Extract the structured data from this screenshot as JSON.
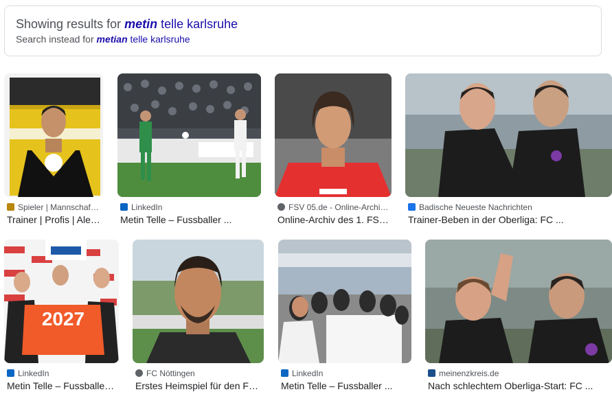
{
  "spelling": {
    "showing_prefix": "Showing results for",
    "corrected_bold": "metin",
    "corrected_rest": "telle karlsruhe",
    "instead_prefix": "Search instead for",
    "original_bold": "metian",
    "original_rest": "telle karlsruhe"
  },
  "results": [
    {
      "source": "Spieler | Mannschaf…",
      "title": "Trainer | Profis | Ale…",
      "favicon": "badge-icon",
      "color": "#b8860b"
    },
    {
      "source": "LinkedIn",
      "title": "Metin Telle – Fussballer ...",
      "favicon": "linkedin-icon",
      "color": "#0a66c2"
    },
    {
      "source": "FSV 05.de - Online-Archi…",
      "title": "Online-Archiv des 1. FS…",
      "favicon": "globe-icon",
      "color": "#5f6368"
    },
    {
      "source": "Badische Neueste Nachrichten",
      "title": "Trainer-Beben in der Oberliga: FC ...",
      "favicon": "bnn-icon",
      "color": "#1a73e8"
    },
    {
      "source": "LinkedIn",
      "title": "Metin Telle – Fussballe…",
      "favicon": "linkedin-icon",
      "color": "#0a66c2"
    },
    {
      "source": "FC Nöttingen",
      "title": "Erstes Heimspiel für den F…",
      "favicon": "globe-icon",
      "color": "#5f6368"
    },
    {
      "source": "LinkedIn",
      "title": "Metin Telle – Fussballer ...",
      "favicon": "linkedin-icon",
      "color": "#0a66c2"
    },
    {
      "source": "meinenzkreis.de",
      "title": "Nach schlechtem Oberliga-Start: FC ...",
      "favicon": "mz-icon",
      "color": "#1a4f8b"
    }
  ],
  "jersey_text": "2027"
}
